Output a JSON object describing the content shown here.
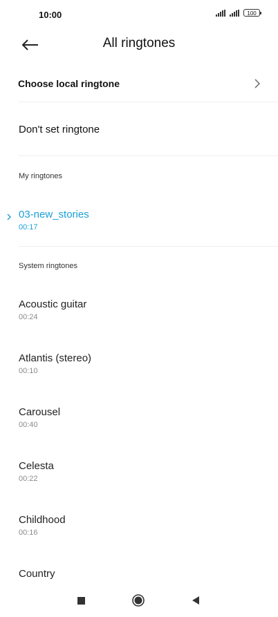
{
  "status_bar": {
    "time": "10:00",
    "battery": "100"
  },
  "header": {
    "title": "All ringtones"
  },
  "choose_local": {
    "label": "Choose local ringtone"
  },
  "dont_set": {
    "label": "Don't set ringtone"
  },
  "my_ringtones": {
    "title": "My ringtones",
    "items": [
      {
        "name": "03-new_stories",
        "duration": "00:17",
        "selected": true
      }
    ]
  },
  "system_ringtones": {
    "title": "System ringtones",
    "items": [
      {
        "name": "Acoustic guitar",
        "duration": "00:24"
      },
      {
        "name": "Atlantis (stereo)",
        "duration": "00:10"
      },
      {
        "name": "Carousel",
        "duration": "00:40"
      },
      {
        "name": "Celesta",
        "duration": "00:22"
      },
      {
        "name": "Childhood",
        "duration": "00:16"
      },
      {
        "name": "Country",
        "duration": ""
      }
    ]
  },
  "colors": {
    "accent": "#1a9fd6",
    "text": "#111111",
    "secondary": "#8a8a8a"
  },
  "icons": {
    "back": "back-arrow-icon",
    "chevron": "chevron-right-icon",
    "selected": "selected-indicator-icon"
  }
}
